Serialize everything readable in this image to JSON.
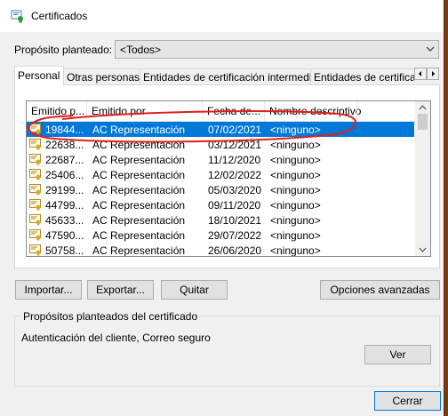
{
  "window": {
    "title": "Certificados"
  },
  "purpose": {
    "label": "Propósito planteado:",
    "value": "<Todos>"
  },
  "tabs": [
    {
      "label": "Personal",
      "active": true
    },
    {
      "label": "Otras personas",
      "active": false
    },
    {
      "label": "Entidades de certificación intermedias",
      "active": false
    },
    {
      "label": "Entidades de certificación raíz",
      "active": false
    }
  ],
  "list": {
    "columns": [
      "Emitido p...",
      "Emitido por",
      "Fecha de...",
      "Nombre descriptivo"
    ],
    "rows": [
      {
        "issued_to": "19844...",
        "issued_by": "AC Representación",
        "date": "07/02/2021",
        "name": "<ninguno>",
        "selected": true
      },
      {
        "issued_to": "22638...",
        "issued_by": "AC Representación",
        "date": "03/12/2021",
        "name": "<ninguno>"
      },
      {
        "issued_to": "22687...",
        "issued_by": "AC Representación",
        "date": "11/12/2020",
        "name": "<ninguno>"
      },
      {
        "issued_to": "25406...",
        "issued_by": "AC Representación",
        "date": "12/02/2022",
        "name": "<ninguno>"
      },
      {
        "issued_to": "29199...",
        "issued_by": "AC Representación",
        "date": "05/03/2020",
        "name": "<ninguno>"
      },
      {
        "issued_to": "44799...",
        "issued_by": "AC Representación",
        "date": "09/11/2020",
        "name": "<ninguno>"
      },
      {
        "issued_to": "45633...",
        "issued_by": "AC Representación",
        "date": "18/10/2021",
        "name": "<ninguno>"
      },
      {
        "issued_to": "47590...",
        "issued_by": "AC Representación",
        "date": "29/07/2022",
        "name": "<ninguno>"
      },
      {
        "issued_to": "50758...",
        "issued_by": "AC Representación",
        "date": "26/06/2020",
        "name": "<ninguno>"
      }
    ]
  },
  "buttons": {
    "import": "Importar...",
    "export": "Exportar...",
    "remove": "Quitar",
    "advanced": "Opciones avanzadas",
    "view": "Ver",
    "close": "Cerrar"
  },
  "purposes_group": {
    "title": "Propósitos planteados del certificado",
    "value": "Autenticación del cliente, Correo seguro"
  },
  "colors": {
    "selection": "#0078d7",
    "annotation": "#e0201b",
    "background": "#7a3a12"
  }
}
